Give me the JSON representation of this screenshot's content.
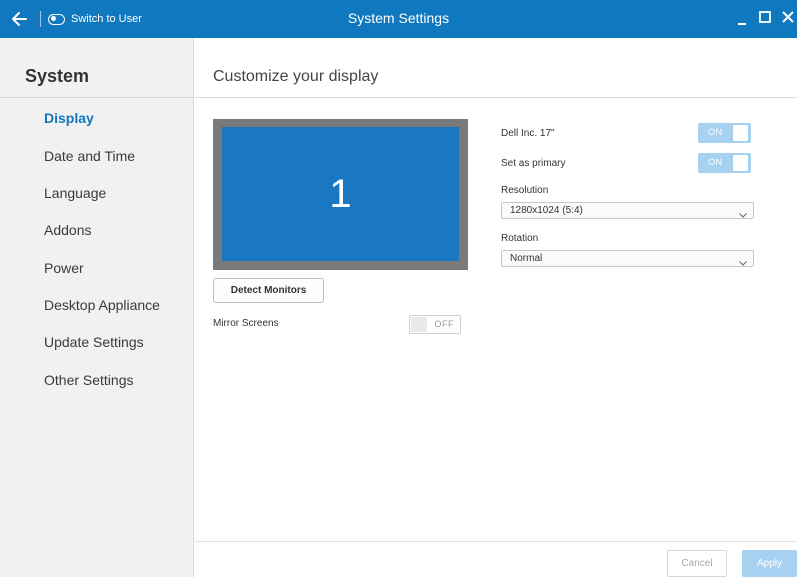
{
  "window": {
    "title": "System Settings",
    "switch_label": "Switch to User",
    "accent_color": "#1078be"
  },
  "sidebar": {
    "title": "System",
    "items": [
      {
        "label": "Display",
        "active": true
      },
      {
        "label": "Date and Time",
        "active": false
      },
      {
        "label": "Language",
        "active": false
      },
      {
        "label": "Addons",
        "active": false
      },
      {
        "label": "Power",
        "active": false
      },
      {
        "label": "Desktop Appliance",
        "active": false
      },
      {
        "label": "Update Settings",
        "active": false
      },
      {
        "label": "Other Settings",
        "active": false
      }
    ]
  },
  "main": {
    "title": "Customize your display",
    "monitor_number": "1",
    "detect_button": "Detect Monitors",
    "mirror": {
      "label": "Mirror Screens",
      "state": "OFF"
    },
    "monitor_toggle": {
      "label": "Dell Inc. 17\"",
      "state": "ON"
    },
    "primary_toggle": {
      "label": "Set as primary",
      "state": "ON"
    },
    "resolution": {
      "label": "Resolution",
      "value": "1280x1024 (5:4)"
    },
    "rotation": {
      "label": "Rotation",
      "value": "Normal"
    }
  },
  "footer": {
    "cancel": "Cancel",
    "apply": "Apply"
  }
}
